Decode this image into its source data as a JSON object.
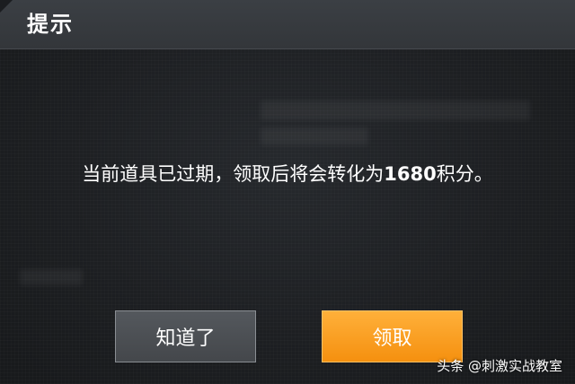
{
  "dialog": {
    "title": "提示",
    "message": {
      "prefix": "当前道具已过期，领取后将会转化为",
      "amount": "1680",
      "suffix": "积分。"
    },
    "buttons": {
      "know_label": "知道了",
      "claim_label": "领取"
    }
  },
  "watermark": "头条 @刺激实战教室",
  "colors": {
    "header": "#373a3e",
    "panel": "#1d1f22",
    "primary_button": "#f7981a",
    "secondary_button": "#4c4f53"
  }
}
